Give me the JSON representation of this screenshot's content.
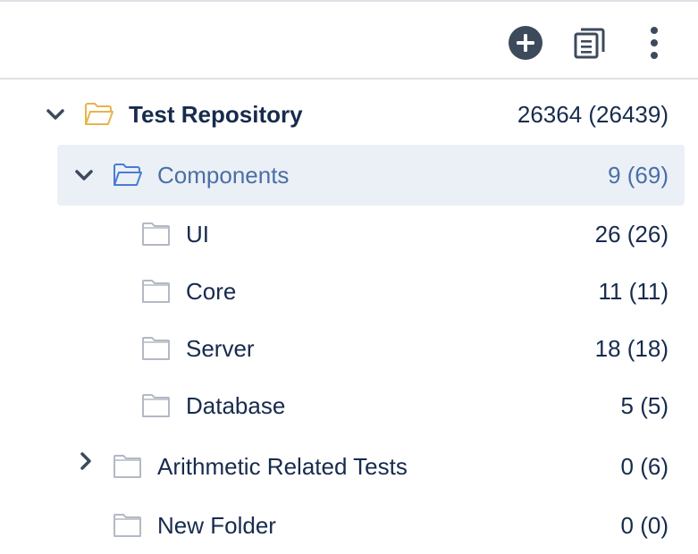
{
  "toolbar": {
    "add_icon": "plus-circle-icon",
    "columns_icon": "stacked-pages-icon",
    "more_icon": "vertical-ellipsis-icon"
  },
  "tree": {
    "root": {
      "label": "Test Repository",
      "count": "26364 (26439)",
      "expanded": true
    },
    "items": [
      {
        "label": "Components",
        "count": "9 (69)",
        "expanded": true,
        "selected": true
      },
      {
        "label": "UI",
        "count": "26 (26)"
      },
      {
        "label": "Core",
        "count": "11 (11)"
      },
      {
        "label": "Server",
        "count": "18 (18)"
      },
      {
        "label": "Database",
        "count": "5 (5)"
      },
      {
        "label": "Arithmetic Related Tests",
        "count": "0 (6)",
        "expanded": false
      },
      {
        "label": "New Folder",
        "count": "0 (0)"
      }
    ]
  },
  "colors": {
    "selected_bg": "#ebf0f7",
    "selected_text": "#4a6fa5",
    "folder_open": "#e8b44c",
    "folder_open_selected": "#4a7bd4",
    "folder_closed": "#b3b9c4",
    "text": "#172b4d"
  }
}
